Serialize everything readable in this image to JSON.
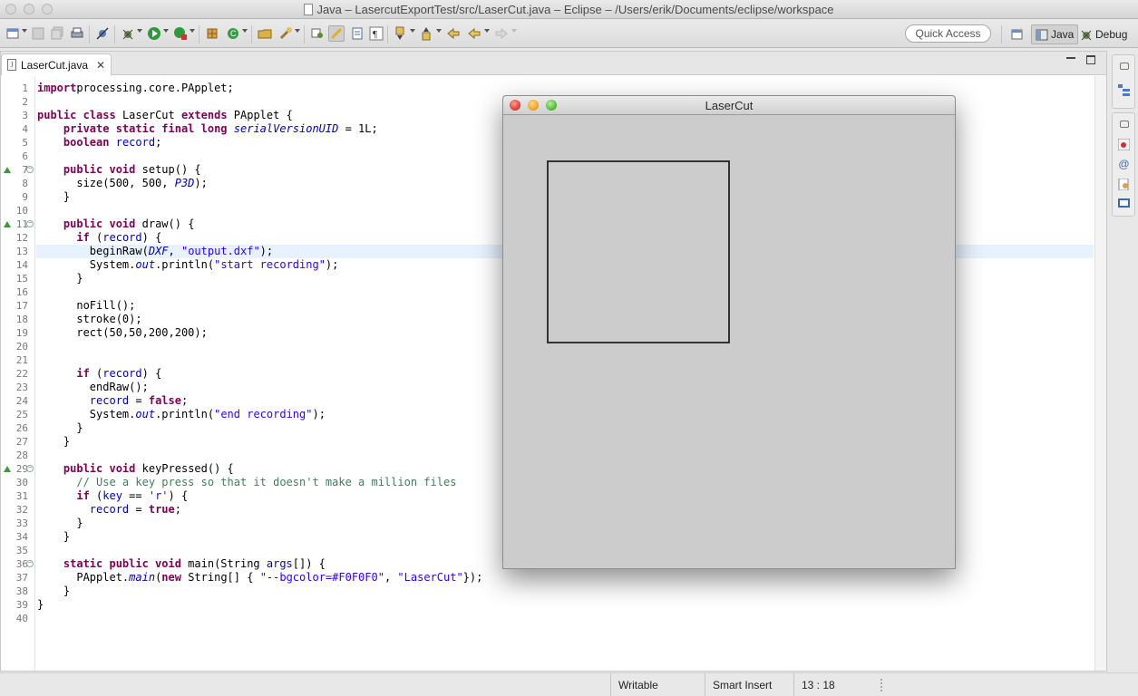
{
  "window": {
    "title": "Java – LasercutExportTest/src/LaserCut.java – Eclipse – /Users/erik/Documents/eclipse/workspace"
  },
  "toolbar": {
    "quick_access": "Quick Access",
    "perspectives": [
      {
        "label": "Java",
        "active": true
      },
      {
        "label": "Debug",
        "active": false
      }
    ]
  },
  "editor": {
    "tab_label": "LaserCut.java",
    "current_line": 13,
    "lines": [
      {
        "n": "1",
        "segs": [
          [
            "kw",
            "import"
          ],
          [
            "",
            "processing.core.PApplet;"
          ]
        ]
      },
      {
        "n": "2",
        "segs": []
      },
      {
        "n": "3",
        "segs": [
          [
            "kw",
            "public"
          ],
          [
            "",
            " "
          ],
          [
            "kw",
            "class"
          ],
          [
            "",
            " LaserCut "
          ],
          [
            "kw",
            "extends"
          ],
          [
            "",
            " PApplet {"
          ]
        ]
      },
      {
        "n": "4",
        "segs": [
          [
            "",
            "    "
          ],
          [
            "kw",
            "private static final long"
          ],
          [
            "",
            " "
          ],
          [
            "it",
            "serialVersionUID"
          ],
          [
            "",
            " = 1L;"
          ]
        ]
      },
      {
        "n": "5",
        "segs": [
          [
            "",
            "    "
          ],
          [
            "kw",
            "boolean"
          ],
          [
            "",
            " "
          ],
          [
            "fld",
            "record"
          ],
          [
            ";",
            ";"
          ]
        ]
      },
      {
        "n": "6",
        "segs": []
      },
      {
        "n": "7",
        "segs": [
          [
            "",
            "    "
          ],
          [
            "kw",
            "public void"
          ],
          [
            "",
            " setup() {"
          ]
        ],
        "override": true,
        "fold": true
      },
      {
        "n": "8",
        "segs": [
          [
            "",
            "      size(500, 500, "
          ],
          [
            "it",
            "P3D"
          ],
          [
            "",
            ");"
          ]
        ]
      },
      {
        "n": "9",
        "segs": [
          [
            "",
            "    }"
          ]
        ]
      },
      {
        "n": "10",
        "segs": []
      },
      {
        "n": "11",
        "segs": [
          [
            "",
            "    "
          ],
          [
            "kw",
            "public void"
          ],
          [
            "",
            " draw() {"
          ]
        ],
        "override": true,
        "fold": true
      },
      {
        "n": "12",
        "segs": [
          [
            "",
            "      "
          ],
          [
            "kw",
            "if"
          ],
          [
            "",
            " ("
          ],
          [
            "fld",
            "record"
          ],
          [
            "",
            ") {"
          ]
        ]
      },
      {
        "n": "13",
        "segs": [
          [
            "",
            "        beginRaw("
          ],
          [
            "it",
            "DXF"
          ],
          [
            "",
            ", "
          ],
          [
            "st",
            "\"output.dxf\""
          ],
          [
            "",
            ");"
          ]
        ]
      },
      {
        "n": "14",
        "segs": [
          [
            "",
            "        System."
          ],
          [
            "it",
            "out"
          ],
          [
            "",
            ".println("
          ],
          [
            "st",
            "\"start recording\""
          ],
          [
            "",
            ");"
          ]
        ]
      },
      {
        "n": "15",
        "segs": [
          [
            "",
            "      }"
          ]
        ]
      },
      {
        "n": "16",
        "segs": []
      },
      {
        "n": "17",
        "segs": [
          [
            "",
            "      noFill();"
          ]
        ]
      },
      {
        "n": "18",
        "segs": [
          [
            "",
            "      stroke(0);"
          ]
        ]
      },
      {
        "n": "19",
        "segs": [
          [
            "",
            "      rect(50,50,200,200);"
          ]
        ]
      },
      {
        "n": "20",
        "segs": []
      },
      {
        "n": "21",
        "segs": []
      },
      {
        "n": "22",
        "segs": [
          [
            "",
            "      "
          ],
          [
            "kw",
            "if"
          ],
          [
            "",
            " ("
          ],
          [
            "fld",
            "record"
          ],
          [
            "",
            ") {"
          ]
        ]
      },
      {
        "n": "23",
        "segs": [
          [
            "",
            "        endRaw();"
          ]
        ]
      },
      {
        "n": "24",
        "segs": [
          [
            "",
            "        "
          ],
          [
            "fld",
            "record"
          ],
          [
            "",
            " = "
          ],
          [
            "kw",
            "false"
          ],
          [
            "",
            ";"
          ]
        ]
      },
      {
        "n": "25",
        "segs": [
          [
            "",
            "        System."
          ],
          [
            "it",
            "out"
          ],
          [
            "",
            ".println("
          ],
          [
            "st",
            "\"end recording\""
          ],
          [
            "",
            ");"
          ]
        ]
      },
      {
        "n": "26",
        "segs": [
          [
            "",
            "      }"
          ]
        ]
      },
      {
        "n": "27",
        "segs": [
          [
            "",
            "    }"
          ]
        ]
      },
      {
        "n": "28",
        "segs": []
      },
      {
        "n": "29",
        "segs": [
          [
            "",
            "    "
          ],
          [
            "kw",
            "public void"
          ],
          [
            "",
            " keyPressed() {"
          ]
        ],
        "override": true,
        "fold": true
      },
      {
        "n": "30",
        "segs": [
          [
            "",
            "      "
          ],
          [
            "cm",
            "// Use a key press so that it doesn't make a million files"
          ]
        ]
      },
      {
        "n": "31",
        "segs": [
          [
            "",
            "      "
          ],
          [
            "kw",
            "if"
          ],
          [
            "",
            " ("
          ],
          [
            "fld",
            "key"
          ],
          [
            "",
            " == "
          ],
          [
            "st",
            "'r'"
          ],
          [
            "",
            ") {"
          ]
        ]
      },
      {
        "n": "32",
        "segs": [
          [
            "",
            "        "
          ],
          [
            "fld",
            "record"
          ],
          [
            "",
            " = "
          ],
          [
            "kw",
            "true"
          ],
          [
            "",
            ";"
          ]
        ]
      },
      {
        "n": "33",
        "segs": [
          [
            "",
            "      }"
          ]
        ]
      },
      {
        "n": "34",
        "segs": [
          [
            "",
            "    }"
          ]
        ]
      },
      {
        "n": "35",
        "segs": []
      },
      {
        "n": "36",
        "segs": [
          [
            "",
            "    "
          ],
          [
            "kw",
            "static public void"
          ],
          [
            "",
            " main(String "
          ],
          [
            "fld",
            "args"
          ],
          [
            "",
            "[]) {"
          ]
        ],
        "fold": true
      },
      {
        "n": "37",
        "segs": [
          [
            "",
            "      PApplet."
          ],
          [
            "it",
            "main"
          ],
          [
            "",
            "("
          ],
          [
            "kw",
            "new"
          ],
          [
            "",
            " String[] { "
          ],
          [
            "st",
            "\"--bgcolor=#F0F0F0\""
          ],
          [
            "",
            ", "
          ],
          [
            "st",
            "\"LaserCut\""
          ],
          [
            "",
            "});"
          ]
        ]
      },
      {
        "n": "38",
        "segs": [
          [
            "",
            "    }"
          ]
        ]
      },
      {
        "n": "39",
        "segs": [
          [
            "",
            "}"
          ]
        ]
      },
      {
        "n": "40",
        "segs": []
      }
    ]
  },
  "status": {
    "writable": "Writable",
    "insert_mode": "Smart Insert",
    "position": "13 : 18"
  },
  "applet": {
    "title": "LaserCut",
    "background": "#cccccc",
    "rect_stroke": "#333333"
  },
  "colors": {
    "keyword": "#7f0055",
    "string": "#2a00ff",
    "field": "#0000c0",
    "comment": "#3f7f5f",
    "current_line": "#e8f2fe"
  }
}
